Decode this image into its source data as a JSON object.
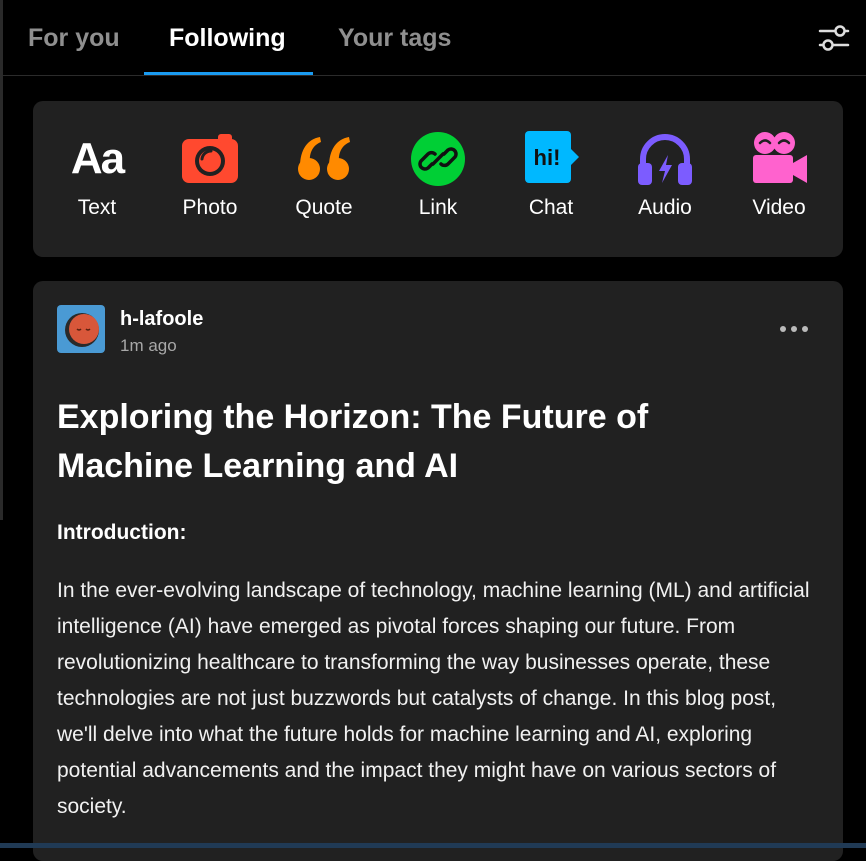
{
  "tabs": [
    {
      "label": "For you",
      "active": false
    },
    {
      "label": "Following",
      "active": true
    },
    {
      "label": "Your tags",
      "active": false
    }
  ],
  "header": {
    "settings_icon": "sliders-icon"
  },
  "composer": {
    "items": [
      {
        "label": "Text",
        "glyph": "Aa",
        "icon": "text-icon",
        "color": "#ffffff"
      },
      {
        "label": "Photo",
        "icon": "camera-icon",
        "color": "#ff492f"
      },
      {
        "label": "Quote",
        "glyph": "“",
        "icon": "quote-icon",
        "color": "#ff8a00"
      },
      {
        "label": "Link",
        "icon": "link-icon",
        "color": "#00cf35"
      },
      {
        "label": "Chat",
        "glyph": "hi!",
        "icon": "chat-icon",
        "color": "#00b8ff"
      },
      {
        "label": "Audio",
        "icon": "headphones-icon",
        "color": "#7c5cff"
      },
      {
        "label": "Video",
        "icon": "video-camera-icon",
        "color": "#ff62ce"
      }
    ]
  },
  "post": {
    "username": "h-lafoole",
    "timestamp": "1m ago",
    "avatar_colors": {
      "bg": "#4a9ad4",
      "face": "#d8573a"
    },
    "title": "Exploring the Horizon: The Future of Machine Learning and AI",
    "section_heading": "Introduction:",
    "body": "In the ever-evolving landscape of technology, machine learning (ML) and artificial intelligence (AI) have emerged as pivotal forces shaping our future. From revolutionizing healthcare to transforming the way businesses operate, these technologies are not just buzzwords but catalysts of change. In this blog post, we'll delve into what the future holds for machine learning and AI, exploring potential advancements and the impact they might have on various sectors of society."
  }
}
